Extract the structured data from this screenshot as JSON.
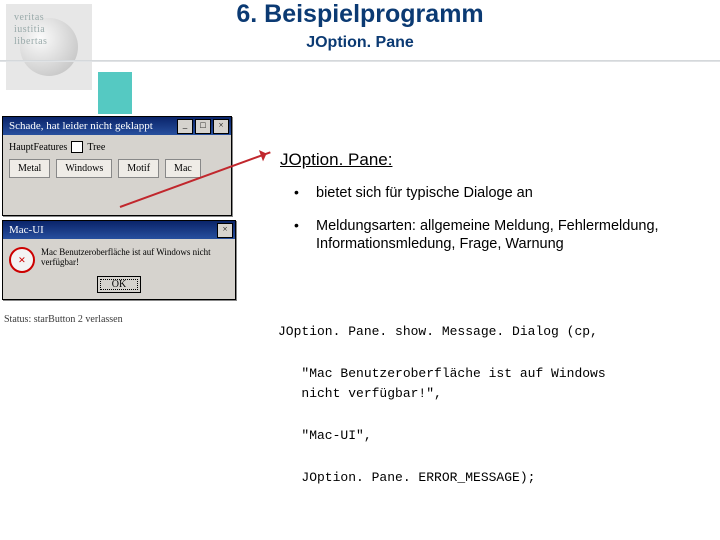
{
  "header": {
    "title": "6. Beispielprogramm",
    "subtitle": "JOption. Pane",
    "logo_words": [
      "veritas",
      "iustitia",
      "libertas"
    ]
  },
  "section_heading": "JOption. Pane:",
  "bullets": [
    "bietet sich für typische Dialoge an",
    "Meldungsarten: allgemeine Meldung, Fehlermeldung, Informationsmledung, Frage, Warnung"
  ],
  "code": {
    "l1": "JOption. Pane. show. Message. Dialog (cp,",
    "l2": "   \"Mac Benutzeroberfläche ist auf Windows",
    "l3": "   nicht verfügbar!\",",
    "l4": "   \"Mac-UI\",",
    "l5": "   JOption. Pane. ERROR_MESSAGE);"
  },
  "screenshot": {
    "win1": {
      "title": "Schade, hat leider nicht geklappt",
      "row_label": "HauptFeatures",
      "row_value": "Tree",
      "tabs": [
        "Metal",
        "Windows",
        "Motif",
        "Mac"
      ]
    },
    "win2": {
      "title": "Mac-UI",
      "message": "Mac Benutzeroberfläche ist auf Windows nicht verfügbar!",
      "ok": "OK"
    },
    "status": "Status: starButton 2 verlassen"
  }
}
